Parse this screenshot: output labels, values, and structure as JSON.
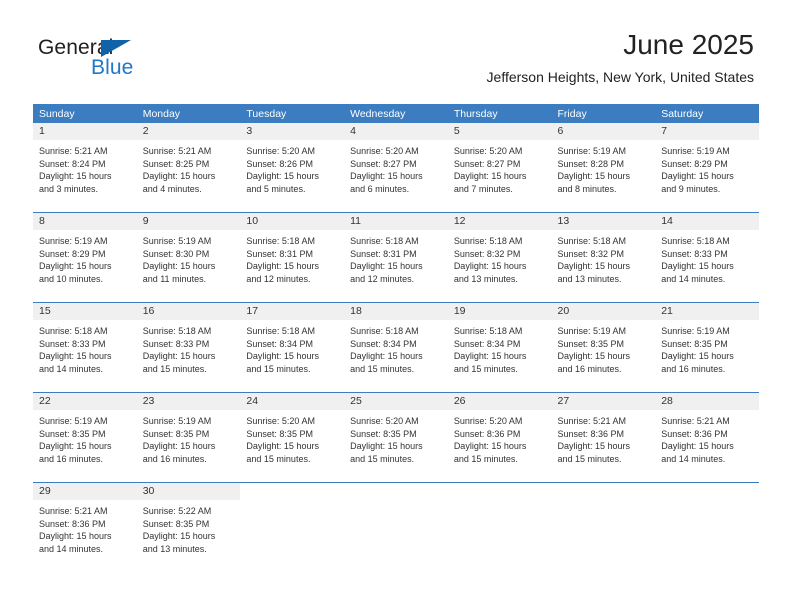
{
  "brand": {
    "name_top": "General",
    "name_bottom": "Blue",
    "triangle_color": "#1063a8",
    "blue_text_color": "#2079c8"
  },
  "header": {
    "title": "June 2025",
    "subtitle": "Jefferson Heights, New York, United States"
  },
  "theme": {
    "header_blue": "#3b7dc0",
    "daynum_background": "#f0f0f0",
    "text_color": "#333333"
  },
  "weekdays": [
    "Sunday",
    "Monday",
    "Tuesday",
    "Wednesday",
    "Thursday",
    "Friday",
    "Saturday"
  ],
  "weeks": [
    [
      {
        "day": "1",
        "sunrise": "Sunrise: 5:21 AM",
        "sunset": "Sunset: 8:24 PM",
        "daylight_1": "Daylight: 15 hours",
        "daylight_2": "and 3 minutes."
      },
      {
        "day": "2",
        "sunrise": "Sunrise: 5:21 AM",
        "sunset": "Sunset: 8:25 PM",
        "daylight_1": "Daylight: 15 hours",
        "daylight_2": "and 4 minutes."
      },
      {
        "day": "3",
        "sunrise": "Sunrise: 5:20 AM",
        "sunset": "Sunset: 8:26 PM",
        "daylight_1": "Daylight: 15 hours",
        "daylight_2": "and 5 minutes."
      },
      {
        "day": "4",
        "sunrise": "Sunrise: 5:20 AM",
        "sunset": "Sunset: 8:27 PM",
        "daylight_1": "Daylight: 15 hours",
        "daylight_2": "and 6 minutes."
      },
      {
        "day": "5",
        "sunrise": "Sunrise: 5:20 AM",
        "sunset": "Sunset: 8:27 PM",
        "daylight_1": "Daylight: 15 hours",
        "daylight_2": "and 7 minutes."
      },
      {
        "day": "6",
        "sunrise": "Sunrise: 5:19 AM",
        "sunset": "Sunset: 8:28 PM",
        "daylight_1": "Daylight: 15 hours",
        "daylight_2": "and 8 minutes."
      },
      {
        "day": "7",
        "sunrise": "Sunrise: 5:19 AM",
        "sunset": "Sunset: 8:29 PM",
        "daylight_1": "Daylight: 15 hours",
        "daylight_2": "and 9 minutes."
      }
    ],
    [
      {
        "day": "8",
        "sunrise": "Sunrise: 5:19 AM",
        "sunset": "Sunset: 8:29 PM",
        "daylight_1": "Daylight: 15 hours",
        "daylight_2": "and 10 minutes."
      },
      {
        "day": "9",
        "sunrise": "Sunrise: 5:19 AM",
        "sunset": "Sunset: 8:30 PM",
        "daylight_1": "Daylight: 15 hours",
        "daylight_2": "and 11 minutes."
      },
      {
        "day": "10",
        "sunrise": "Sunrise: 5:18 AM",
        "sunset": "Sunset: 8:31 PM",
        "daylight_1": "Daylight: 15 hours",
        "daylight_2": "and 12 minutes."
      },
      {
        "day": "11",
        "sunrise": "Sunrise: 5:18 AM",
        "sunset": "Sunset: 8:31 PM",
        "daylight_1": "Daylight: 15 hours",
        "daylight_2": "and 12 minutes."
      },
      {
        "day": "12",
        "sunrise": "Sunrise: 5:18 AM",
        "sunset": "Sunset: 8:32 PM",
        "daylight_1": "Daylight: 15 hours",
        "daylight_2": "and 13 minutes."
      },
      {
        "day": "13",
        "sunrise": "Sunrise: 5:18 AM",
        "sunset": "Sunset: 8:32 PM",
        "daylight_1": "Daylight: 15 hours",
        "daylight_2": "and 13 minutes."
      },
      {
        "day": "14",
        "sunrise": "Sunrise: 5:18 AM",
        "sunset": "Sunset: 8:33 PM",
        "daylight_1": "Daylight: 15 hours",
        "daylight_2": "and 14 minutes."
      }
    ],
    [
      {
        "day": "15",
        "sunrise": "Sunrise: 5:18 AM",
        "sunset": "Sunset: 8:33 PM",
        "daylight_1": "Daylight: 15 hours",
        "daylight_2": "and 14 minutes."
      },
      {
        "day": "16",
        "sunrise": "Sunrise: 5:18 AM",
        "sunset": "Sunset: 8:33 PM",
        "daylight_1": "Daylight: 15 hours",
        "daylight_2": "and 15 minutes."
      },
      {
        "day": "17",
        "sunrise": "Sunrise: 5:18 AM",
        "sunset": "Sunset: 8:34 PM",
        "daylight_1": "Daylight: 15 hours",
        "daylight_2": "and 15 minutes."
      },
      {
        "day": "18",
        "sunrise": "Sunrise: 5:18 AM",
        "sunset": "Sunset: 8:34 PM",
        "daylight_1": "Daylight: 15 hours",
        "daylight_2": "and 15 minutes."
      },
      {
        "day": "19",
        "sunrise": "Sunrise: 5:18 AM",
        "sunset": "Sunset: 8:34 PM",
        "daylight_1": "Daylight: 15 hours",
        "daylight_2": "and 15 minutes."
      },
      {
        "day": "20",
        "sunrise": "Sunrise: 5:19 AM",
        "sunset": "Sunset: 8:35 PM",
        "daylight_1": "Daylight: 15 hours",
        "daylight_2": "and 16 minutes."
      },
      {
        "day": "21",
        "sunrise": "Sunrise: 5:19 AM",
        "sunset": "Sunset: 8:35 PM",
        "daylight_1": "Daylight: 15 hours",
        "daylight_2": "and 16 minutes."
      }
    ],
    [
      {
        "day": "22",
        "sunrise": "Sunrise: 5:19 AM",
        "sunset": "Sunset: 8:35 PM",
        "daylight_1": "Daylight: 15 hours",
        "daylight_2": "and 16 minutes."
      },
      {
        "day": "23",
        "sunrise": "Sunrise: 5:19 AM",
        "sunset": "Sunset: 8:35 PM",
        "daylight_1": "Daylight: 15 hours",
        "daylight_2": "and 16 minutes."
      },
      {
        "day": "24",
        "sunrise": "Sunrise: 5:20 AM",
        "sunset": "Sunset: 8:35 PM",
        "daylight_1": "Daylight: 15 hours",
        "daylight_2": "and 15 minutes."
      },
      {
        "day": "25",
        "sunrise": "Sunrise: 5:20 AM",
        "sunset": "Sunset: 8:35 PM",
        "daylight_1": "Daylight: 15 hours",
        "daylight_2": "and 15 minutes."
      },
      {
        "day": "26",
        "sunrise": "Sunrise: 5:20 AM",
        "sunset": "Sunset: 8:36 PM",
        "daylight_1": "Daylight: 15 hours",
        "daylight_2": "and 15 minutes."
      },
      {
        "day": "27",
        "sunrise": "Sunrise: 5:21 AM",
        "sunset": "Sunset: 8:36 PM",
        "daylight_1": "Daylight: 15 hours",
        "daylight_2": "and 15 minutes."
      },
      {
        "day": "28",
        "sunrise": "Sunrise: 5:21 AM",
        "sunset": "Sunset: 8:36 PM",
        "daylight_1": "Daylight: 15 hours",
        "daylight_2": "and 14 minutes."
      }
    ],
    [
      {
        "day": "29",
        "sunrise": "Sunrise: 5:21 AM",
        "sunset": "Sunset: 8:36 PM",
        "daylight_1": "Daylight: 15 hours",
        "daylight_2": "and 14 minutes."
      },
      {
        "day": "30",
        "sunrise": "Sunrise: 5:22 AM",
        "sunset": "Sunset: 8:35 PM",
        "daylight_1": "Daylight: 15 hours",
        "daylight_2": "and 13 minutes."
      },
      {
        "day": "",
        "sunrise": "",
        "sunset": "",
        "daylight_1": "",
        "daylight_2": ""
      },
      {
        "day": "",
        "sunrise": "",
        "sunset": "",
        "daylight_1": "",
        "daylight_2": ""
      },
      {
        "day": "",
        "sunrise": "",
        "sunset": "",
        "daylight_1": "",
        "daylight_2": ""
      },
      {
        "day": "",
        "sunrise": "",
        "sunset": "",
        "daylight_1": "",
        "daylight_2": ""
      },
      {
        "day": "",
        "sunrise": "",
        "sunset": "",
        "daylight_1": "",
        "daylight_2": ""
      }
    ]
  ]
}
